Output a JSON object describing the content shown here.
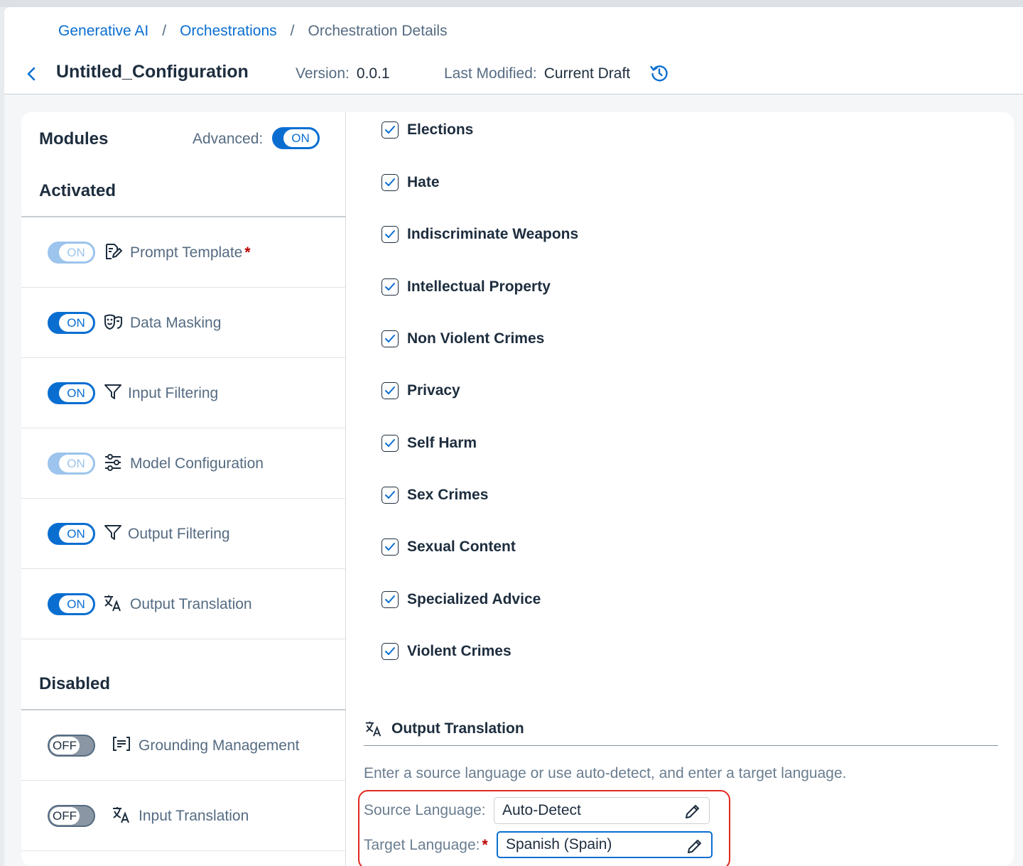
{
  "breadcrumb": {
    "items": [
      "Generative AI",
      "Orchestrations"
    ],
    "current": "Orchestration Details",
    "separator": "/"
  },
  "header": {
    "title": "Untitled_Configuration",
    "version_label": "Version:",
    "version_value": "0.0.1",
    "modified_label": "Last Modified:",
    "modified_value": "Current Draft"
  },
  "modules": {
    "heading": "Modules",
    "advanced_label": "Advanced:",
    "advanced_state": "ON",
    "activated_heading": "Activated",
    "disabled_heading": "Disabled",
    "activated": [
      {
        "label": "Prompt Template",
        "state": "ON",
        "required": "*",
        "icon": "prompt-edit-icon",
        "enabled": false
      },
      {
        "label": "Data Masking",
        "state": "ON",
        "icon": "masks-icon",
        "enabled": true
      },
      {
        "label": "Input Filtering",
        "state": "ON",
        "icon": "filter-icon",
        "enabled": true
      },
      {
        "label": "Model Configuration",
        "state": "ON",
        "icon": "sliders-icon",
        "enabled": false
      },
      {
        "label": "Output Filtering",
        "state": "ON",
        "icon": "filter-icon",
        "enabled": true
      },
      {
        "label": "Output Translation",
        "state": "ON",
        "icon": "translate-icon",
        "enabled": true
      }
    ],
    "disabled": [
      {
        "label": "Grounding Management",
        "state": "OFF",
        "icon": "grounding-icon"
      },
      {
        "label": "Input Translation",
        "state": "OFF",
        "icon": "translate-icon"
      }
    ]
  },
  "filters": [
    {
      "label": "Elections",
      "checked": true
    },
    {
      "label": "Hate",
      "checked": true
    },
    {
      "label": "Indiscriminate Weapons",
      "checked": true
    },
    {
      "label": "Intellectual Property",
      "checked": true
    },
    {
      "label": "Non Violent Crimes",
      "checked": true
    },
    {
      "label": "Privacy",
      "checked": true
    },
    {
      "label": "Self Harm",
      "checked": true
    },
    {
      "label": "Sex Crimes",
      "checked": true
    },
    {
      "label": "Sexual Content",
      "checked": true
    },
    {
      "label": "Specialized Advice",
      "checked": true
    },
    {
      "label": "Violent Crimes",
      "checked": true
    }
  ],
  "output_translation": {
    "heading": "Output Translation",
    "description": "Enter a source language or use auto-detect, and enter a target language.",
    "source_label": "Source Language:",
    "source_value": "Auto-Detect",
    "target_label": "Target Language:",
    "target_required": "*",
    "target_value": "Spanish (Spain)"
  },
  "colors": {
    "accent": "#0a6ed1",
    "highlight_box": "#e0281e",
    "required": "#bb0000"
  }
}
